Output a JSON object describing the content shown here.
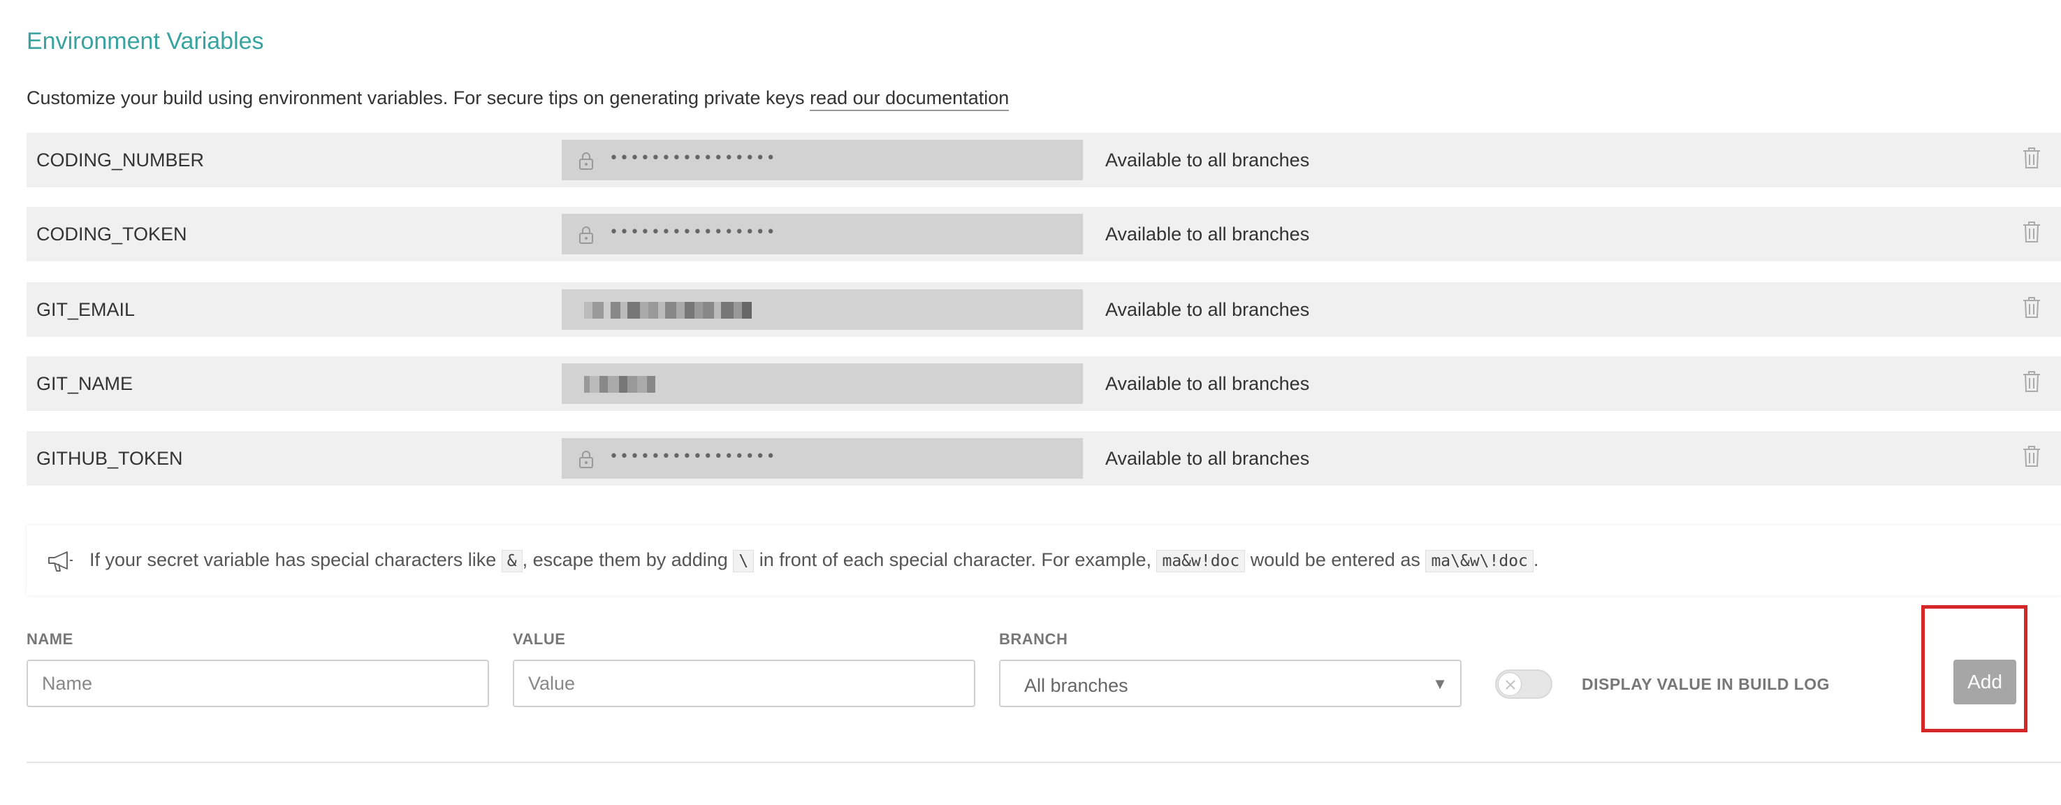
{
  "header": {
    "title": "Environment Variables",
    "description": "Customize your build using environment variables. For secure tips on generating private keys ",
    "doc_link": "read our documentation"
  },
  "env_vars": [
    {
      "name": "CODING_NUMBER",
      "value_display": "••••••••••••••••",
      "secret": true,
      "branch": "Available to all branches"
    },
    {
      "name": "CODING_TOKEN",
      "value_display": "••••••••••••••••",
      "secret": true,
      "branch": "Available to all branches"
    },
    {
      "name": "GIT_EMAIL",
      "value_display": "",
      "secret": false,
      "blurred": true,
      "branch": "Available to all branches"
    },
    {
      "name": "GIT_NAME",
      "value_display": "",
      "secret": false,
      "blurred": true,
      "branch": "Available to all branches"
    },
    {
      "name": "GITHUB_TOKEN",
      "value_display": "••••••••••••••••",
      "secret": true,
      "branch": "Available to all branches"
    }
  ],
  "notice": {
    "part1": "If your secret variable has special characters like ",
    "code1": "&",
    "part2": ", escape them by adding ",
    "code2": "\\",
    "part3": " in front of each special character. For example, ",
    "code3": "ma&w!doc",
    "part4": " would be entered as ",
    "code4": "ma\\&w\\!doc",
    "part5": "."
  },
  "form": {
    "name_label": "NAME",
    "name_placeholder": "Name",
    "value_label": "VALUE",
    "value_placeholder": "Value",
    "branch_label": "BRANCH",
    "branch_selected": "All branches",
    "display_toggle_label": "DISPLAY VALUE IN BUILD LOG",
    "display_toggle_on": false,
    "add_label": "Add"
  },
  "colors": {
    "accent": "#39a3a0",
    "highlight": "#d62728",
    "row_bg": "#f0f0f0",
    "value_bg": "#d2d2d2",
    "button_bg": "#a6a6a6"
  },
  "icons": [
    "lock-icon",
    "trash-icon",
    "megaphone-icon",
    "chevron-down-icon",
    "close-icon"
  ]
}
